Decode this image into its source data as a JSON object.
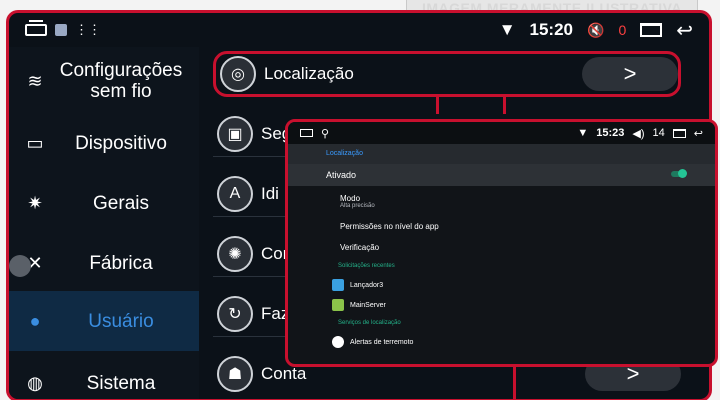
{
  "banner_text": "IMAGEM MERAMENTE ILUSTRATIVA",
  "statusbar": {
    "time": "15:20",
    "volume": "0",
    "icons": [
      "home-icon",
      "app-square-icon",
      "notification-dots-icon",
      "wifi-icon",
      "volume-muted-icon",
      "recent-apps-icon",
      "back-icon"
    ]
  },
  "sidebar": {
    "items": [
      {
        "label": "Configurações sem fio",
        "icon": "wifi-icon"
      },
      {
        "label": "Dispositivo",
        "icon": "monitor-icon"
      },
      {
        "label": "Gerais",
        "icon": "gear-icon"
      },
      {
        "label": "Fábrica",
        "icon": "tools-icon"
      },
      {
        "label": "Usuário",
        "icon": "user-icon",
        "active": true
      },
      {
        "label": "Sistema",
        "icon": "globe-icon"
      }
    ]
  },
  "main": {
    "rows": [
      {
        "label": "Localização",
        "icon": "location-target-icon"
      },
      {
        "label": "Seg",
        "icon": "lock-icon"
      },
      {
        "label": "Idi",
        "icon": "language-icon"
      },
      {
        "label": "Con",
        "icon": "settings-cog-icon"
      },
      {
        "label": "Faz",
        "icon": "refresh-icon"
      },
      {
        "label": "Conta",
        "icon": "android-icon"
      }
    ],
    "arrow_glyph": ">"
  },
  "inset": {
    "status_time": "15:23",
    "status_volume": "14",
    "header": "Localização",
    "enabled_label": "Ativado",
    "enabled": true,
    "mode_label": "Modo",
    "mode_value": "Alta precisão",
    "permissions_label": "Permissões no nível do app",
    "verification_label": "Verificação",
    "recent_requests_header": "Solicitações recentes",
    "recent_apps": [
      "Lançador3",
      "MainServer"
    ],
    "services_header": "Serviços de localização",
    "services": [
      "Alertas de terremoto"
    ]
  },
  "colors": {
    "highlight": "#c8102e",
    "accent_blue": "#3a8de0",
    "toggle_green": "#24c495"
  }
}
